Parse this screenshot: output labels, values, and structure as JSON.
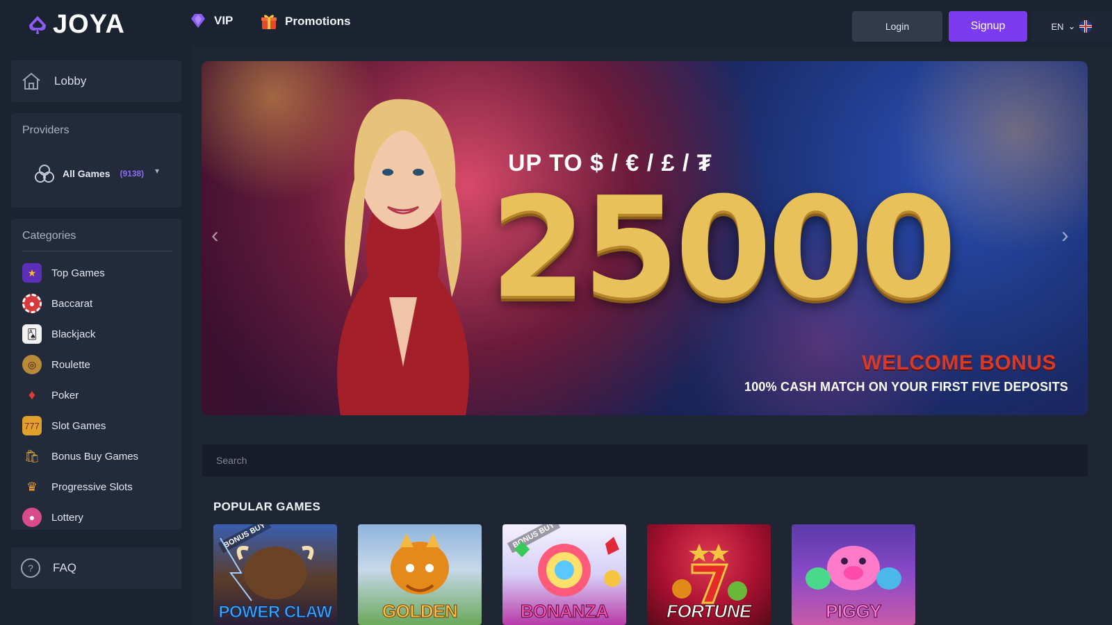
{
  "header": {
    "brand": "JOYA",
    "nav": [
      {
        "label": "VIP",
        "icon": "diamond-icon"
      },
      {
        "label": "Promotions",
        "icon": "gift-icon"
      }
    ],
    "login_label": "Login",
    "signup_label": "Signup",
    "language": "EN",
    "flag": "uk-flag-icon"
  },
  "sidebar": {
    "lobby_label": "Lobby",
    "providers_title": "Providers",
    "all_games_label": "All Games",
    "all_games_count": "(9138)",
    "categories_title": "Categories",
    "categories": [
      {
        "label": "Top Games",
        "icon": "star-icon",
        "color": "#7c3aed"
      },
      {
        "label": "Baccarat",
        "icon": "chip-icon",
        "color": "#e23b3b"
      },
      {
        "label": "Blackjack",
        "icon": "cards-icon",
        "color": "#e6e6e6"
      },
      {
        "label": "Roulette",
        "icon": "roulette-wheel-icon",
        "color": "#caa55a"
      },
      {
        "label": "Poker",
        "icon": "poker-suit-icon",
        "color": "#e53935"
      },
      {
        "label": "Slot Games",
        "icon": "slot-machine-icon",
        "color": "#f2b233"
      },
      {
        "label": "Bonus Buy Games",
        "icon": "bonus-buy-icon",
        "color": "#d4a23a"
      },
      {
        "label": "Progressive Slots",
        "icon": "crown-icon",
        "color": "#f0a030"
      },
      {
        "label": "Lottery",
        "icon": "lottery-ball-icon",
        "color": "#d94c8c"
      }
    ],
    "faq_label": "FAQ"
  },
  "banner": {
    "up_to": "UP TO $ / € / £ / ₮",
    "amount": "25000",
    "welcome": "WELCOME BONUS",
    "match": "100% CASH MATCH ON YOUR FIRST FIVE DEPOSITS"
  },
  "search": {
    "placeholder": "Search"
  },
  "popular": {
    "title": "POPULAR GAMES",
    "games": [
      {
        "name": "POWER CLAW",
        "badge": "BONUS BUY"
      },
      {
        "name": "GOLDEN",
        "badge": ""
      },
      {
        "name": "BONANZA",
        "badge": "BONUS BUY"
      },
      {
        "name": "FORTUNE",
        "badge": ""
      },
      {
        "name": "PIGGY",
        "badge": ""
      }
    ]
  },
  "colors": {
    "background": "#1b2230",
    "panel": "#232b3a",
    "accent": "#7b3cf0",
    "count": "#8b6cf5"
  }
}
